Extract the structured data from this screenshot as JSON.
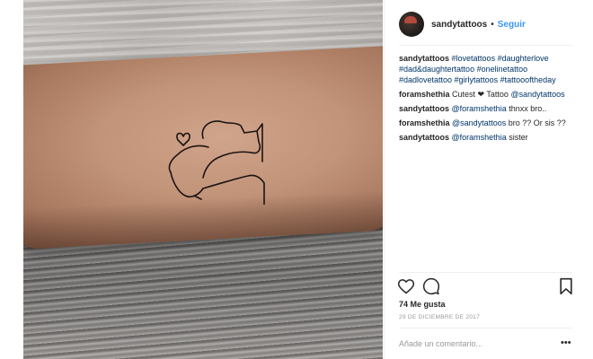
{
  "post": {
    "image": {
      "description_icon": "tattoo-photo"
    }
  },
  "header": {
    "username": "sandytattoos",
    "separator": "•",
    "follow_label": "Seguir"
  },
  "caption": {
    "user": "sandytattoos",
    "text": "#lovetattoos #daughterlove #dad&daughtertattoo #onelinetattoo #dadlovetattoo #girlytattoos #tattoooftheday"
  },
  "comments": [
    {
      "user": "foramshethia",
      "text": "Cutest ❤ Tattoo ",
      "mention": "@sandytattoos",
      "after": ""
    },
    {
      "user": "sandytattoos",
      "text": "",
      "mention": "@foramshethia",
      "after": " thnxx bro.."
    },
    {
      "user": "foramshethia",
      "text": "",
      "mention": "@sandytattoos",
      "after": " bro ?? Or sis ??"
    },
    {
      "user": "sandytattoos",
      "text": "",
      "mention": "@foramshethia",
      "after": " sister"
    }
  ],
  "actions": {
    "icons": [
      "heart-icon",
      "comment-icon",
      "bookmark-icon"
    ]
  },
  "likes": "74 Me gusta",
  "date": "29 DE DICIEMBRE DE 2017",
  "add_comment": {
    "placeholder": "Añade un comentario..."
  },
  "more_label": "•••",
  "colors": {
    "link": "#3897f0",
    "hashtag": "#003569",
    "text": "#262626",
    "muted": "#999999"
  }
}
